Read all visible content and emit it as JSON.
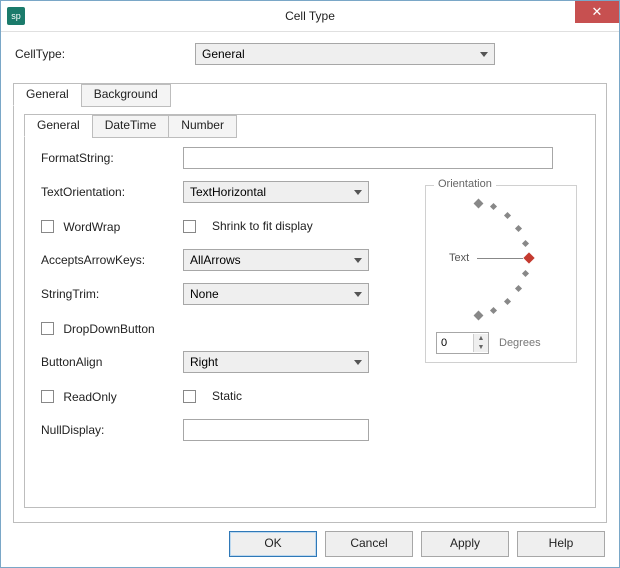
{
  "window": {
    "title": "Cell Type",
    "app_icon_text": "sp",
    "close_glyph": "✕"
  },
  "celltype": {
    "label": "CellType:",
    "value": "General"
  },
  "outer_tabs": [
    "General",
    "Background"
  ],
  "inner_tabs": [
    "General",
    "DateTime",
    "Number"
  ],
  "form": {
    "format_string": {
      "label": "FormatString:",
      "value": ""
    },
    "text_orientation": {
      "label": "TextOrientation:",
      "value": "TextHorizontal"
    },
    "wordwrap": {
      "label": "WordWrap"
    },
    "shrink": {
      "label": "Shrink to fit display"
    },
    "accepts_arrow_keys": {
      "label": "AcceptsArrowKeys:",
      "value": "AllArrows"
    },
    "string_trim": {
      "label": "StringTrim:",
      "value": "None"
    },
    "dropdown_button": {
      "label": "DropDownButton"
    },
    "button_align": {
      "label": "ButtonAlign",
      "value": "Right"
    },
    "readonly": {
      "label": "ReadOnly"
    },
    "static": {
      "label": "Static"
    },
    "null_display": {
      "label": "NullDisplay:",
      "value": ""
    }
  },
  "orientation": {
    "legend": "Orientation",
    "text": "Text",
    "degrees_label": "Degrees",
    "degrees_value": "0"
  },
  "buttons": {
    "ok": "OK",
    "cancel": "Cancel",
    "apply": "Apply",
    "help": "Help"
  }
}
